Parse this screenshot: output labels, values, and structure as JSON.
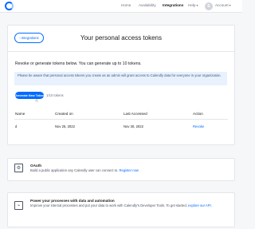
{
  "nav": {
    "home": "Home",
    "availability": "Availability",
    "integrations": "Integrations",
    "help": "Help",
    "account_initial": "E",
    "account": "Account"
  },
  "header": {
    "back_label": "Integrations",
    "title": "Your personal access tokens"
  },
  "tokens": {
    "intro": "Revoke or generate tokens below. You can generate up to 10 tokens.",
    "notice": "Please be aware that personal access tokens you create as an admin will grant access to Calendly data for everyone in your organization.",
    "generate_label": "Generate New Token",
    "count": "1/10 tokens",
    "columns": [
      "Name",
      "Created on",
      "Last Accessed",
      "Action"
    ],
    "rows": [
      {
        "name": "d",
        "created": "Nov 25, 2022",
        "accessed": "Nov 30, 2022",
        "action": "Revoke"
      }
    ]
  },
  "oauth": {
    "title": "OAuth",
    "text": "Build a public application any Calendly user can connect to.",
    "link": "Register now"
  },
  "devtools": {
    "title": "Power your processes with data and automation",
    "text": "Improve your internal processes and put your data to work with Calendly's Developer Tools. To get started,",
    "link": "explore our API."
  },
  "colors": {
    "accent": "#006bff",
    "notice_bg": "#e8f1fd"
  }
}
